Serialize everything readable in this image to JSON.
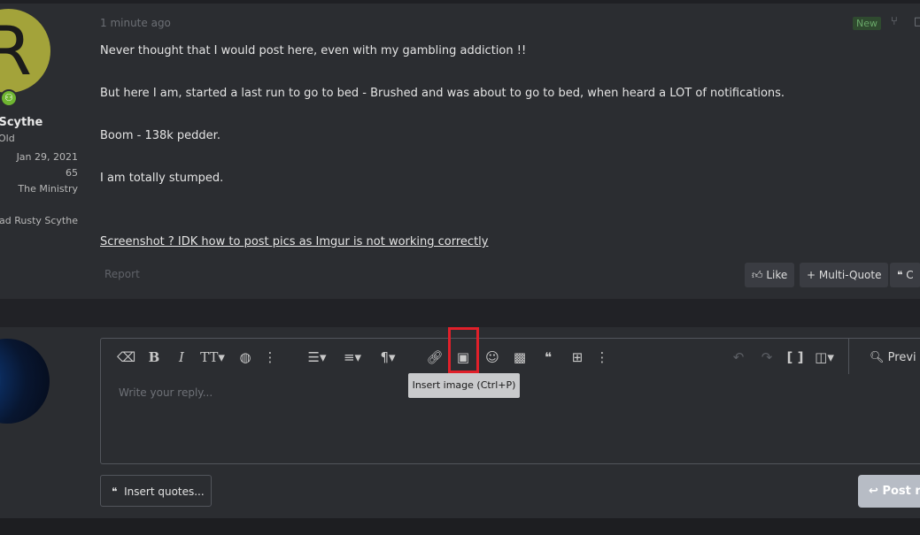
{
  "author": {
    "avatar_letter": "R",
    "avatar_color": "#a3a33a",
    "online_indicator": "online-icon",
    "name": "yScythe",
    "title": "Old",
    "joined": "Jan 29, 2021",
    "messages": "65",
    "location": "The Ministry",
    "signature_name": "Mad Rusty Scythe"
  },
  "post": {
    "timestamp": "1 minute ago",
    "new_badge": "New",
    "lines": [
      "Never thought that I would post here, even with my gambling addiction !!",
      "But here I am, started a last run to go to bed - Brushed and was about to go to bed, when heard a LOT of notifications.",
      "Boom - 138k pedder.",
      "I am totally stumped."
    ],
    "link_text": "Screenshot ? IDK how to post pics as Imgur is not working correctly",
    "report_label": "Report",
    "like_label": "Like",
    "multiquote_label": "Multi-Quote",
    "reply_label": "C"
  },
  "editor": {
    "placeholder": "Write your reply...",
    "tooltip": "Insert image (Ctrl+P)",
    "preview_label": "Previ",
    "toolbar": [
      "eraser-icon",
      "bold-icon",
      "italic-icon",
      "text-size-icon",
      "palette-icon",
      "more-icon",
      "list-icon",
      "align-icon",
      "paragraph-icon",
      "link-icon",
      "image-icon",
      "smiley-icon",
      "media-icon",
      "quote-icon",
      "table-icon",
      "more-icon",
      "undo-icon",
      "redo-icon",
      "bbcode-icon",
      "drafts-icon"
    ],
    "highlight_color": "#e0202a"
  },
  "actions": {
    "insert_quotes_label": "Insert quotes...",
    "post_reply_label": "Post r"
  }
}
